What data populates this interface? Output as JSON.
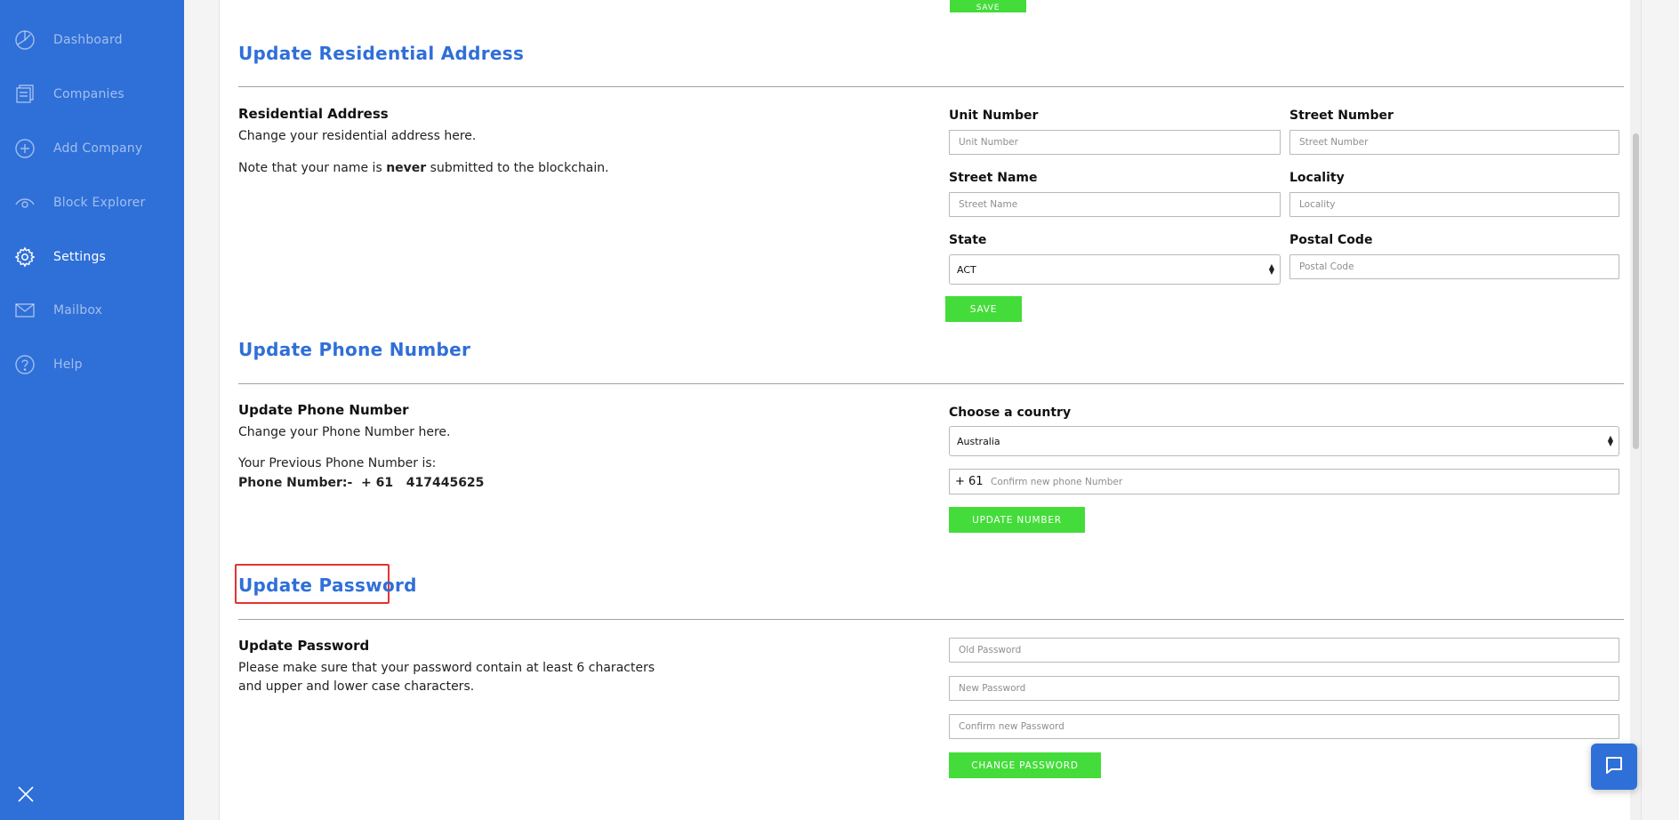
{
  "sidebar": {
    "items": [
      {
        "label": "Dashboard",
        "icon": "dashboard-icon"
      },
      {
        "label": "Companies",
        "icon": "companies-icon"
      },
      {
        "label": "Add Company",
        "icon": "add-circle-icon"
      },
      {
        "label": "Block Explorer",
        "icon": "eye-icon"
      },
      {
        "label": "Settings",
        "icon": "gear-icon",
        "active": true
      },
      {
        "label": "Mailbox",
        "icon": "mail-icon"
      },
      {
        "label": "Help",
        "icon": "help-icon"
      }
    ],
    "close_icon": "close-icon"
  },
  "top": {
    "save_label": "SAVE"
  },
  "address": {
    "title": "Update Residential Address",
    "subtitle": "Residential Address",
    "desc": "Change your residential address here.",
    "note_prefix": "Note that your name is ",
    "note_bold": "never",
    "note_suffix": " submitted to the blockchain.",
    "unit_label": "Unit Number",
    "unit_placeholder": "Unit Number",
    "street_number_label": "Street Number",
    "street_number_placeholder": "Street Number",
    "street_name_label": "Street Name",
    "street_name_placeholder": "Street Name",
    "locality_label": "Locality",
    "locality_placeholder": "Locality",
    "state_label": "State",
    "state_value": "ACT",
    "postal_label": "Postal Code",
    "postal_placeholder": "Postal Code",
    "save_label": "SAVE"
  },
  "phone": {
    "title": "Update Phone Number",
    "subtitle": "Update Phone Number",
    "desc": "Change your Phone Number here.",
    "previous_label": "Your Previous Phone Number is:",
    "previous_number": "Phone Number:-  + 61   417445625",
    "country_label": "Choose a country",
    "country_value": "Australia",
    "prefix": "+ 61",
    "input_placeholder": "Confirm new phone Number",
    "button_label": "UPDATE NUMBER"
  },
  "password": {
    "title": "Update Password",
    "subtitle": "Update Password",
    "desc_line1": "Please make sure that your password contain at least 6 characters",
    "desc_line2": "and upper and lower case characters.",
    "old_placeholder": "Old Password",
    "new_placeholder": "New Password",
    "confirm_placeholder": "Confirm new Password",
    "button_label": "CHANGE PASSWORD"
  },
  "colors": {
    "sidebar": "#2f6fd8",
    "accent": "#2f6fd8",
    "button": "#44dc3a",
    "highlight": "#e53232"
  },
  "chat": {
    "icon": "chat-icon"
  }
}
